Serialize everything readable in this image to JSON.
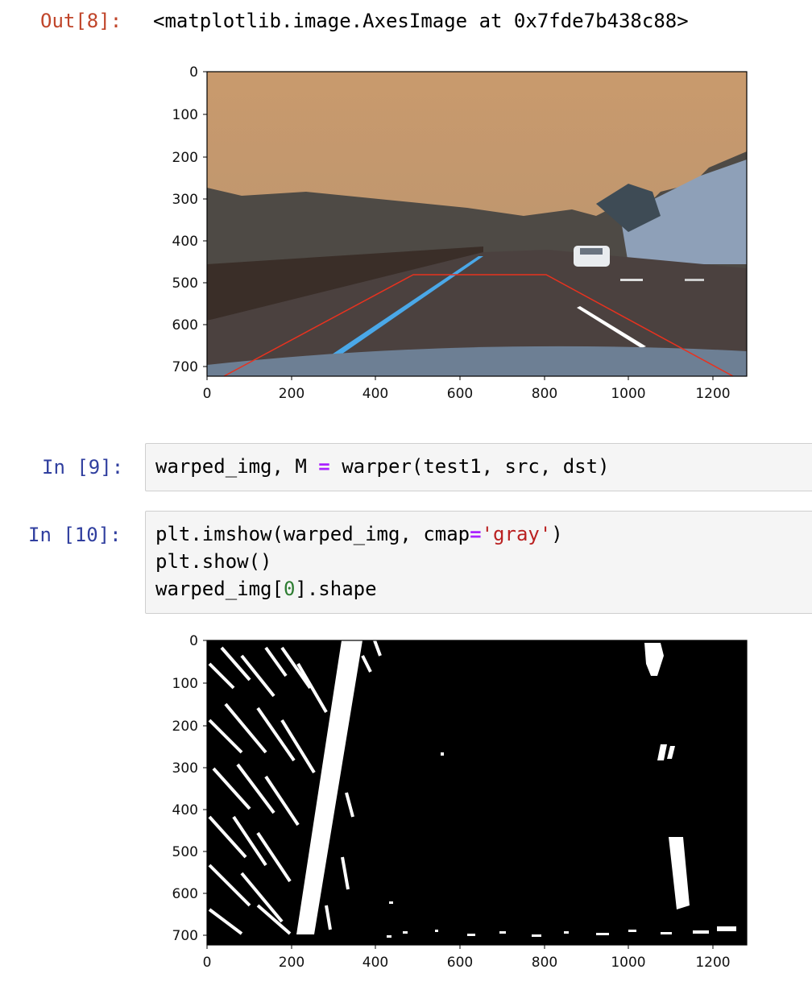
{
  "cells": [
    {
      "prompt": "Out[8]:",
      "output_text": "<matplotlib.image.AxesImage at 0x7fde7b438c88>",
      "figure": {
        "x_ticks": [
          "0",
          "200",
          "400",
          "600",
          "800",
          "1000",
          "1200"
        ],
        "y_ticks": [
          "0",
          "100",
          "200",
          "300",
          "400",
          "500",
          "600",
          "700"
        ],
        "image": "road-photo-with-red-trapezoid"
      }
    },
    {
      "prompt": "In [9]:",
      "code_parts": [
        "warped_img, M ",
        "=",
        " warper(test1, src, dst)"
      ]
    },
    {
      "prompt": "In [10]:",
      "code_lines": [
        {
          "a": "plt.imshow(warped_img, cmap",
          "op": "=",
          "str": "'gray'",
          "b": ")"
        },
        {
          "a": "plt.show()"
        },
        {
          "a": "warped_img[",
          "num": "0",
          "b": "].shape"
        }
      ],
      "figure": {
        "x_ticks": [
          "0",
          "200",
          "400",
          "600",
          "800",
          "1000",
          "1200"
        ],
        "y_ticks": [
          "0",
          "100",
          "200",
          "300",
          "400",
          "500",
          "600",
          "700"
        ],
        "image": "binary-warped-lane-image"
      }
    }
  ]
}
